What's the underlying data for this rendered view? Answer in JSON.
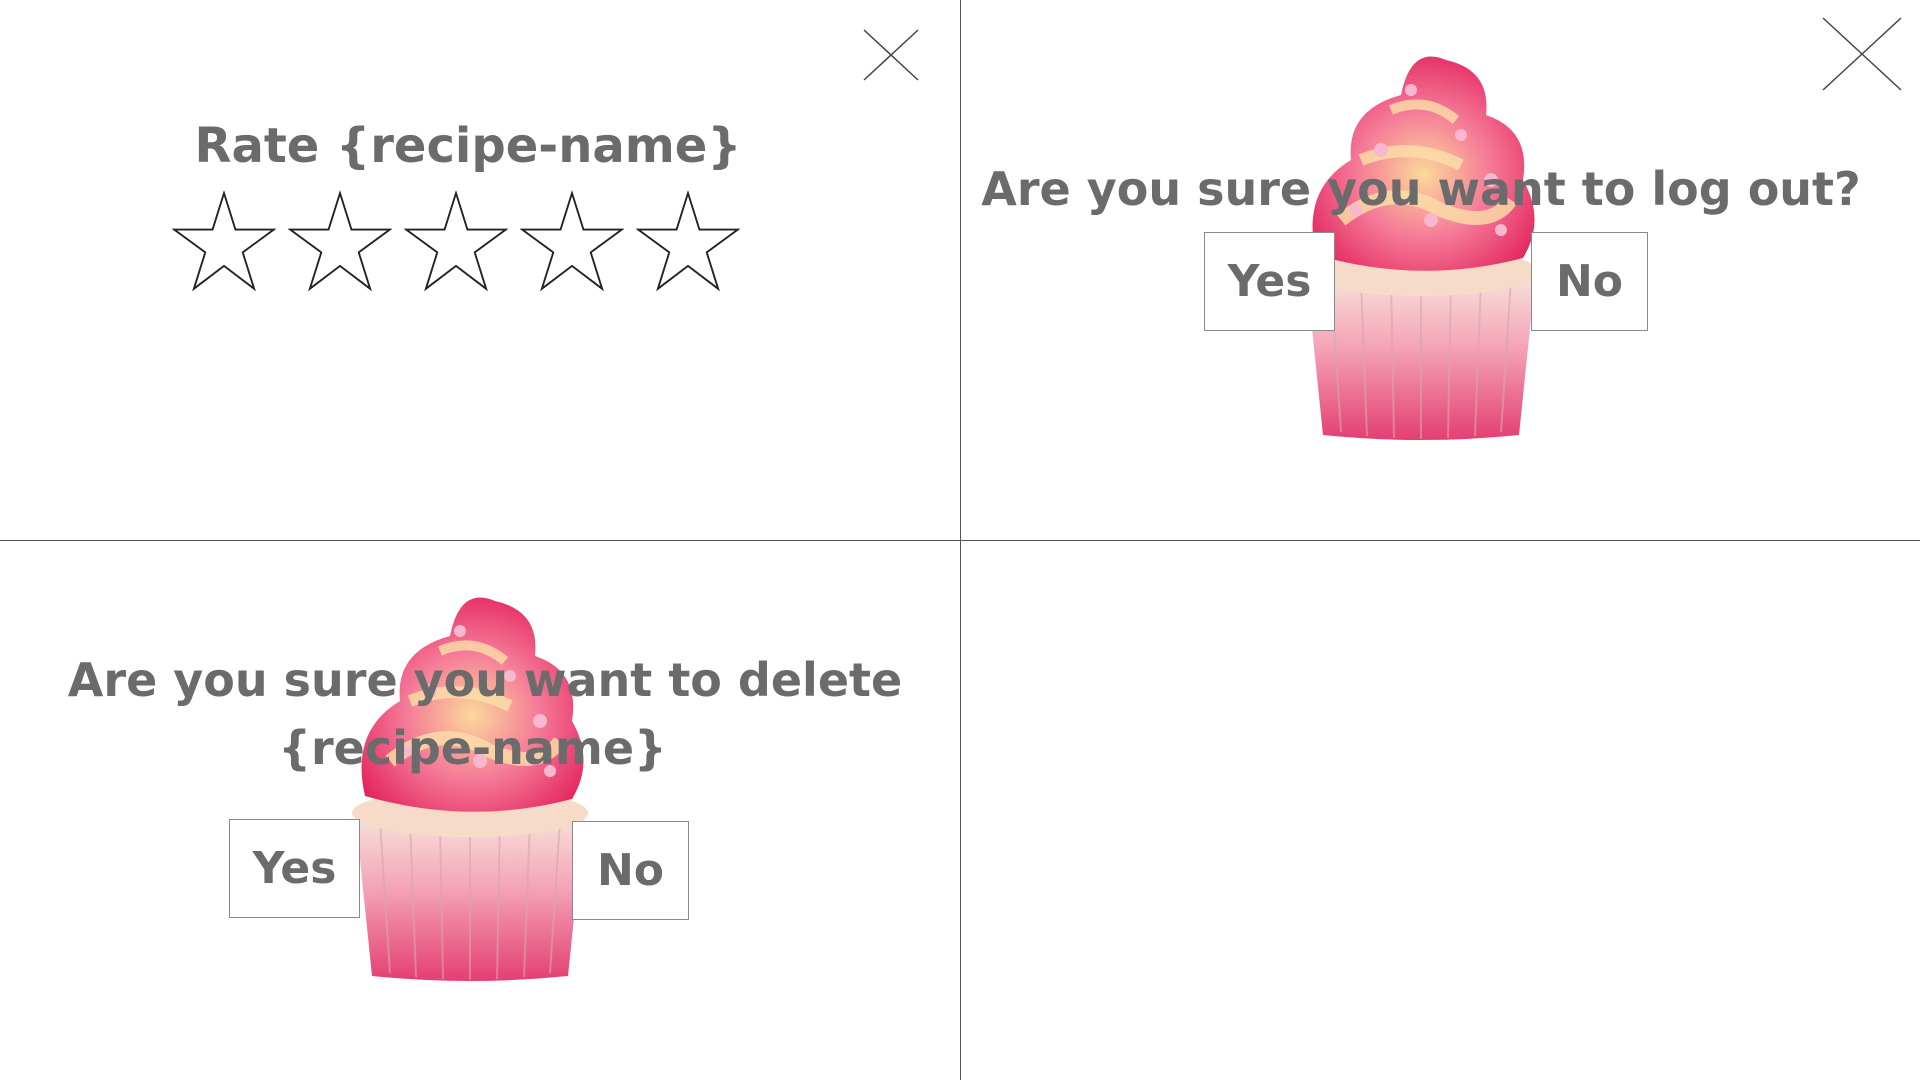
{
  "rating_dialog": {
    "title": "Rate {recipe-name}",
    "star_count": 5,
    "rating_value": 0,
    "star_icon": "star-outline-icon"
  },
  "logout_dialog": {
    "question": "Are you sure you want to log out?",
    "yes_label": "Yes",
    "no_label": "No"
  },
  "delete_dialog": {
    "question_line1": "Are you sure you want to delete",
    "question_line2": "{recipe-name}",
    "yes_label": "Yes",
    "no_label": "No"
  },
  "icons": {
    "close": "close-icon",
    "cupcake": "cupcake-illustration"
  },
  "colors": {
    "text": "#6b6b6b",
    "frosting_dark": "#e8336d",
    "frosting_light": "#f9c27a",
    "wrapper": "#e8557a",
    "cake": "#f6dcc8"
  }
}
